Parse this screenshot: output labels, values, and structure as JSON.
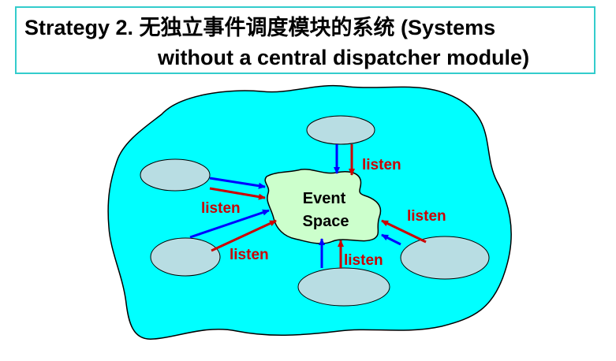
{
  "title": {
    "line1": "Strategy 2.  无独立事件调度模块的系统 (Systems",
    "line2": "without a central dispatcher module)"
  },
  "diagram": {
    "center_label_line1": "Event",
    "center_label_line2": "Space",
    "listen_labels": [
      "listen",
      "listen",
      "listen",
      "listen",
      "listen"
    ],
    "colors": {
      "cloud": "#00ffff",
      "event_space": "#ccffcc",
      "node": "#b8dde3",
      "publish_arrow": "#0000ff",
      "listen_arrow": "#cc0000"
    }
  }
}
